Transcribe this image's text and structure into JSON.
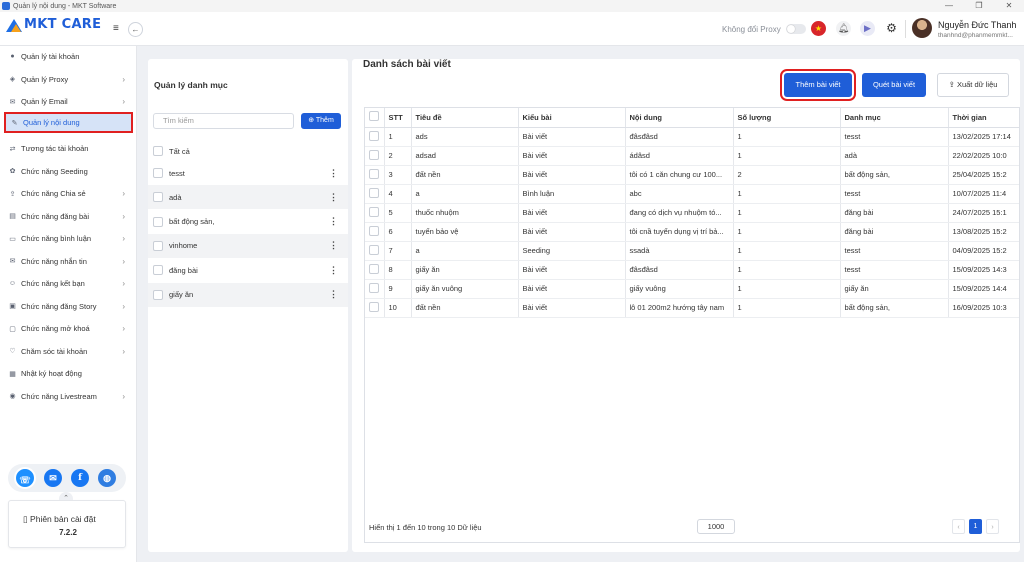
{
  "window": {
    "title": "Quản lý nội dung - MKT Software",
    "controls": [
      "—",
      "❐",
      "✕"
    ]
  },
  "header": {
    "logo_text": "MKT CARE",
    "proxy_label": "Không đổi Proxy",
    "user_name": "Nguyễn Đức Thanh",
    "user_email": "thanhnd@phanmemmkt..."
  },
  "sidebar": {
    "items": [
      {
        "label": "Quản lý tài khoản",
        "icon": "user-icon",
        "chevron": false
      },
      {
        "label": "Quản lý Proxy",
        "icon": "proxy-icon",
        "chevron": true
      },
      {
        "label": "Quản lý Email",
        "icon": "mail-icon",
        "chevron": true
      },
      {
        "label": "Quản lý nội dung",
        "icon": "content-icon",
        "chevron": false,
        "active": true
      },
      {
        "label": "Tương tác tài khoản",
        "icon": "interact-icon",
        "chevron": false
      },
      {
        "label": "Chức năng Seeding",
        "icon": "seeding-icon",
        "chevron": false
      },
      {
        "label": "Chức năng Chia sẻ",
        "icon": "share-icon",
        "chevron": true
      },
      {
        "label": "Chức năng đăng bài",
        "icon": "post-icon",
        "chevron": true
      },
      {
        "label": "Chức năng bình luận",
        "icon": "comment-icon",
        "chevron": true
      },
      {
        "label": "Chức năng nhắn tin",
        "icon": "message-icon",
        "chevron": true
      },
      {
        "label": "Chức năng kết bạn",
        "icon": "friend-icon",
        "chevron": true
      },
      {
        "label": "Chức năng đăng Story",
        "icon": "story-icon",
        "chevron": true
      },
      {
        "label": "Chức năng mở khoá",
        "icon": "unlock-icon",
        "chevron": true
      },
      {
        "label": "Chăm sóc tài khoản",
        "icon": "care-icon",
        "chevron": true
      },
      {
        "label": "Nhật ký hoạt động",
        "icon": "log-icon",
        "chevron": false
      },
      {
        "label": "Chức năng Livestream",
        "icon": "livestream-icon",
        "chevron": true
      }
    ],
    "version_label": "Phiên bản cài đặt",
    "version_number": "7.2.2"
  },
  "categories": {
    "title": "Quản lý danh mục",
    "search_placeholder": "Tìm kiếm",
    "add_label": "Thêm",
    "all_label": "Tất cả",
    "items": [
      "tesst",
      "adà",
      "bất động sản,",
      "vinhome",
      "đăng bài",
      "giấy ăn"
    ]
  },
  "posts": {
    "title": "Danh sách bài viết",
    "add_button": "Thêm bài viết",
    "scan_button": "Quét bài viết",
    "export_button": "Xuất dữ liệu",
    "columns": [
      "STT",
      "Tiêu đề",
      "Kiểu bài",
      "Nội dung",
      "Số lượng",
      "Danh mục",
      "Thời gian"
    ],
    "rows": [
      [
        "1",
        "ads",
        "Bài viết",
        "đâsđâsd",
        "1",
        "tesst",
        "13/02/2025 17:14"
      ],
      [
        "2",
        "adsad",
        "Bài viết",
        "ádâsd",
        "1",
        "adà",
        "22/02/2025 10:0"
      ],
      [
        "3",
        "đất nền",
        "Bài viết",
        "tôi có 1 căn chung cư 100...",
        "2",
        "bất động sản,",
        "25/04/2025 15:2"
      ],
      [
        "4",
        "a",
        "Bình luận",
        "abc",
        "1",
        "tesst",
        "10/07/2025 11:4"
      ],
      [
        "5",
        "thuốc nhuộm",
        "Bài viết",
        "đang có dịch vụ nhuộm tó...",
        "1",
        "đăng bài",
        "24/07/2025 15:1"
      ],
      [
        "6",
        "tuyển bảo vệ",
        "Bài viết",
        "tôi cnầ tuyển dụng vị trí bả...",
        "1",
        "đăng bài",
        "13/08/2025 15:2"
      ],
      [
        "7",
        "a",
        "Seeding",
        "ssadà",
        "1",
        "tesst",
        "04/09/2025 15:2"
      ],
      [
        "8",
        "giấy ăn",
        "Bài viết",
        "đâsđâsd",
        "1",
        "tesst",
        "15/09/2025 14:3"
      ],
      [
        "9",
        "giấy ăn vuông",
        "Bài viết",
        "giấy vuông",
        "1",
        "giấy ăn",
        "15/09/2025 14:4"
      ],
      [
        "10",
        "đất nền",
        "Bài viết",
        "lô 01 200m2 hướng tây nam",
        "1",
        "bất động sản,",
        "16/09/2025 10:3"
      ]
    ],
    "footer_text": "Hiển thị 1 đến 10 trong 10 Dữ liệu",
    "page_size": "1000",
    "current_page": "1"
  }
}
